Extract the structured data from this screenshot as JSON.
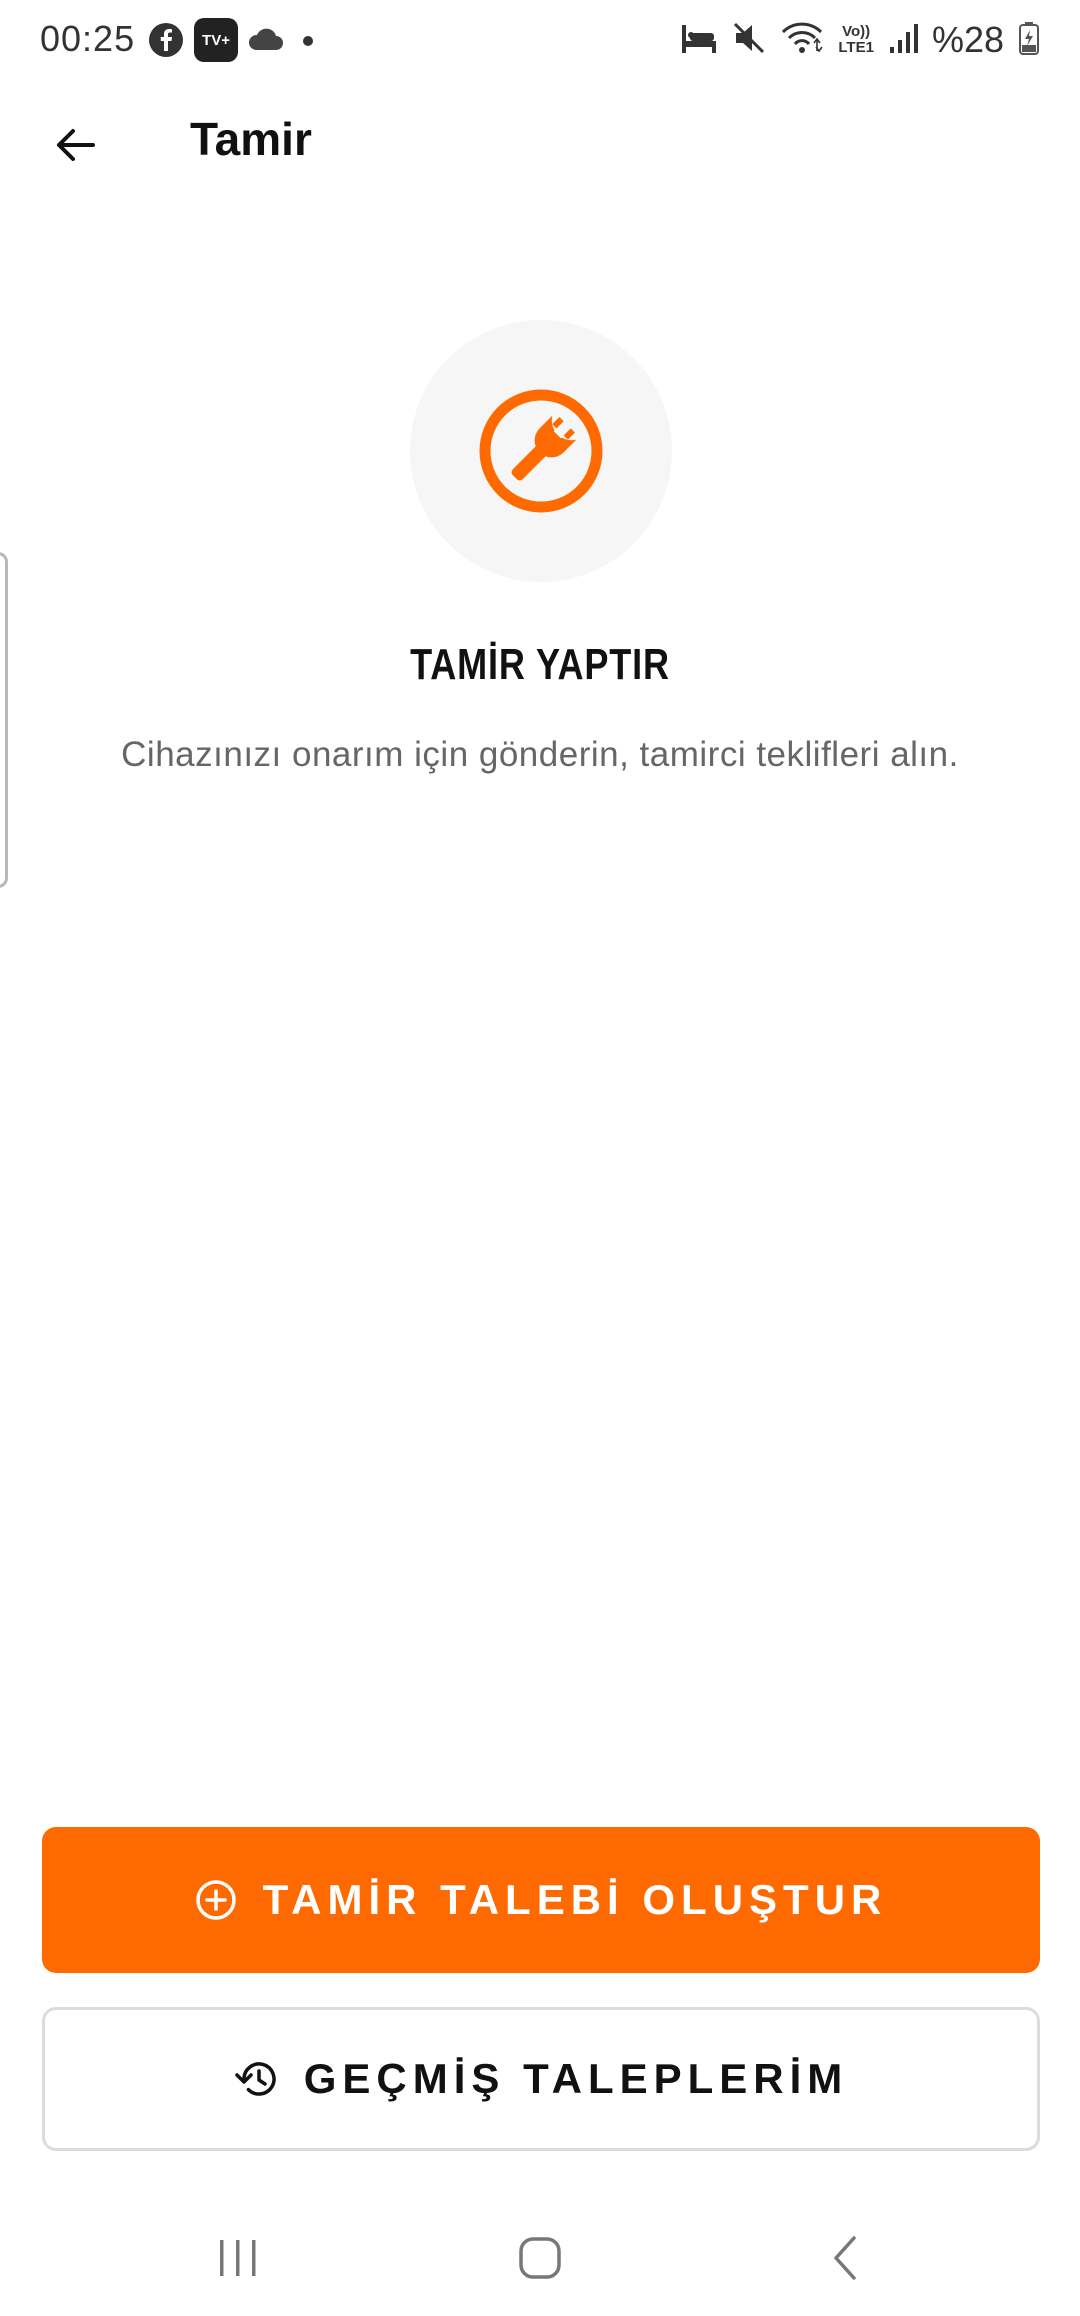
{
  "status_bar": {
    "time": "00:25",
    "battery": "%28",
    "icons": [
      "facebook-icon",
      "tv-plus-icon",
      "cloud-icon",
      "dot-icon",
      "sleep-mode-icon",
      "mute-icon",
      "wifi-icon",
      "volte-lte1-icon",
      "signal-icon",
      "battery-icon"
    ],
    "tv_badge": "TV+",
    "volte_top": "Vo))",
    "volte_bottom": "LTE1"
  },
  "app_bar": {
    "back_icon": "arrow-left-icon",
    "title": "Tamir"
  },
  "hero": {
    "icon": "wrench-circle-icon",
    "title": "TAMİR YAPTIR",
    "subtitle": "Cihazınızı onarım için gönderin, tamirci teklifleri alın."
  },
  "actions": {
    "create_request": {
      "label": "TAMİR TALEBİ OLUŞTUR",
      "icon": "plus-circle-icon"
    },
    "past_requests": {
      "label": "GEÇMİŞ TALEPLERİM",
      "icon": "history-icon"
    }
  },
  "nav_bar": {
    "icons": [
      "recent-apps-icon",
      "home-icon",
      "back-icon"
    ]
  },
  "colors": {
    "accent": "#FF6A00",
    "icon_bg": "#F6F6F6",
    "subtitle_text": "#666666",
    "border": "#DCDCDC"
  }
}
